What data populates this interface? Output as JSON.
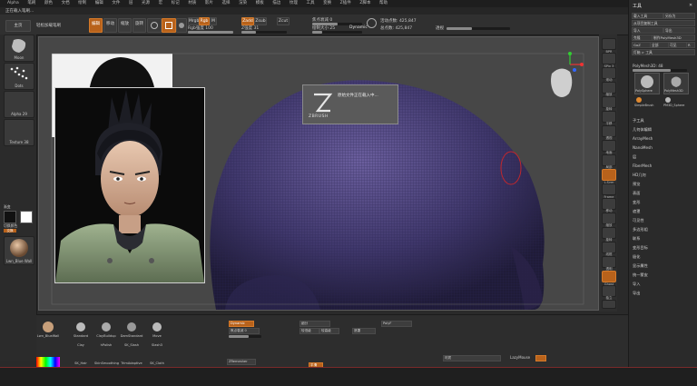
{
  "app": {
    "menu_items": [
      "Alpha",
      "笔刷",
      "颜色",
      "文档",
      "绘制",
      "编辑",
      "文件",
      "层",
      "光源",
      "宏",
      "标记",
      "材质",
      "影片",
      "选择",
      "渲染",
      "模板",
      "描边",
      "纹理",
      "工具",
      "变换",
      "Z插件",
      "Z脚本",
      "帮助"
    ],
    "status_line": "正在载入笔刷..."
  },
  "toolbar": {
    "left_button": "主页",
    "lightbox_label": "轻松加载笔刷",
    "mode_buttons": [
      "编辑",
      "移动",
      "缩放",
      "旋转"
    ],
    "mrgb": "Mrgb",
    "rgb": "Rgb",
    "m": "M",
    "rgb_intensity_label": "Rgb强度 100",
    "zadd": "Zadd",
    "zsub": "Zsub",
    "zcut": "Zcut",
    "z_intensity_label": "Z强度 31",
    "focal_shift_label": "焦点衰减 0",
    "draw_size_label": "绘制大小 25",
    "dynamic": "Dynamic",
    "active_points": "活动点数: 425,847",
    "total_points": "总点数: 425,847",
    "persp": "透视"
  },
  "left_panel": {
    "items": [
      "Moon",
      "Dots",
      "Alpha 29",
      "Texture 38"
    ],
    "gradient_label": "渐变",
    "switch_label": "切换颜色",
    "exchange_label": "交换",
    "material_label": "Lwn_Blue Wall"
  },
  "canvas": {
    "tooltip": "原始文件正在载入中...",
    "zbrush_logo": "ZBRUSH"
  },
  "right_strip": {
    "icons": [
      "BPR",
      "SPix 3",
      "滚动",
      "缩放",
      "旋转",
      "平移",
      "透视",
      "地面",
      "局部",
      "L.Sym",
      "Frame",
      "移动",
      "缩放",
      "旋转",
      "线框",
      "透明",
      "Ghost",
      "独立",
      "Xpose"
    ]
  },
  "right_panel": {
    "title": "工具",
    "buttons": [
      "载入工具",
      "另存为",
      "从项目复制工具",
      "导入",
      "导出",
      "克隆",
      "制作PolyMesh3D",
      "GoZ",
      "全部",
      "可见",
      "R",
      "灯箱 > 工具"
    ],
    "polymesh_label": "PolyMesh3D: 48",
    "thumbs": [
      "PolySphere",
      "PolyMesh3D",
      "SimpleBrush",
      "PM3D_Sphere"
    ],
    "menu": [
      "子工具",
      "几何体编辑",
      "ArrayMesh",
      "NanoMesh",
      "层",
      "FiberMesh",
      "HD几何",
      "预览",
      "表面",
      "变形",
      "遮罩",
      "可见性",
      "多边形组",
      "联系",
      "变形目标",
      "极化",
      "显示属性",
      "统一蒙皮",
      "导入",
      "导出"
    ]
  },
  "bottom_panel": {
    "brush_thumbs": [
      "Lwn_BlueWall",
      "Standard",
      "ClayBuildup",
      "DamStandard",
      "Move",
      "Clay",
      "hPolish",
      "SK_Slash",
      "Slash3",
      "Inflat",
      "DamStandard",
      "SK_Slash"
    ],
    "row2_thumbs": [
      "SK_Hair",
      "SkinSmoothing",
      "TrimAdaptive",
      "SK_Cloth"
    ],
    "dynamic_btn": "Dynamic",
    "focal": "焦点衰减 0",
    "ztime": "ZRemesher",
    "subdiv": "细分",
    "lower": "较低级",
    "higher": "较高级",
    "smooth": "平滑",
    "mask": "遮罩",
    "polyf": "PolyF",
    "persp_right": "材质",
    "status_right": "LazyMouse"
  }
}
